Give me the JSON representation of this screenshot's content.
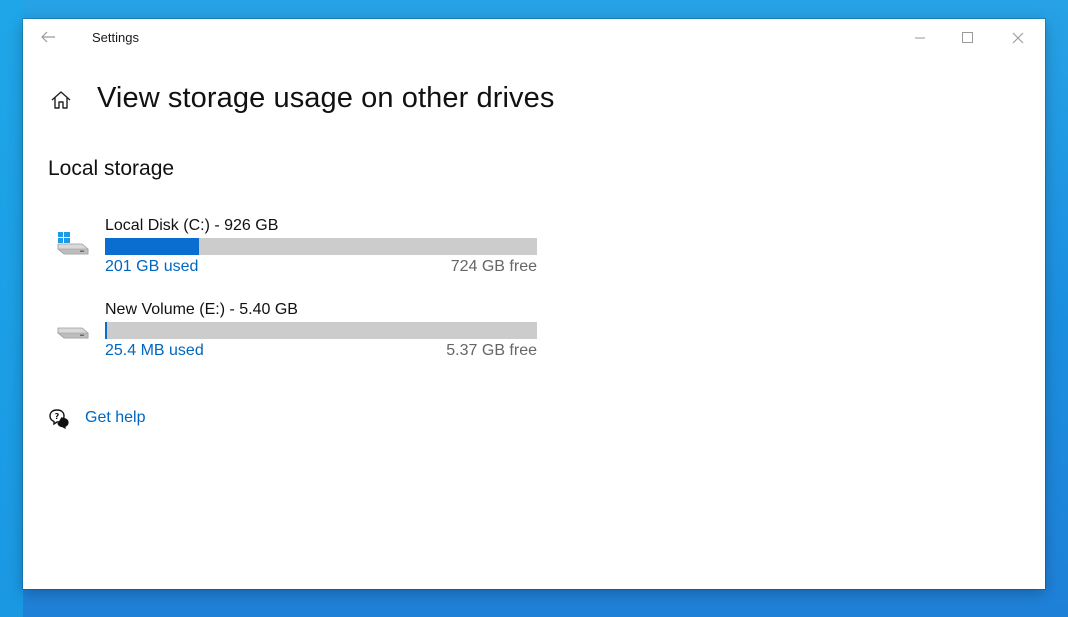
{
  "window": {
    "title": "Settings",
    "controls": [
      "minimize",
      "maximize",
      "close"
    ]
  },
  "page": {
    "title": "View storage usage on other drives",
    "home_icon": "home-icon"
  },
  "section": {
    "title": "Local storage"
  },
  "drives": [
    {
      "name": "Local Disk (C:) - 926 GB",
      "used": "201 GB used",
      "free": "724 GB free",
      "used_fraction": 0.217,
      "icon": "system-drive-icon"
    },
    {
      "name": "New Volume (E:) - 5.40 GB",
      "used": "25.4 MB used",
      "free": "5.37 GB free",
      "used_fraction": 0.0046,
      "icon": "drive-icon"
    }
  ],
  "help": {
    "label": "Get help",
    "icon": "help-chat-icon"
  },
  "colors": {
    "accent": "#0a6ed1",
    "link": "#0067c0",
    "bar_track": "#cccccc",
    "desktop": "#1c8fe0"
  }
}
